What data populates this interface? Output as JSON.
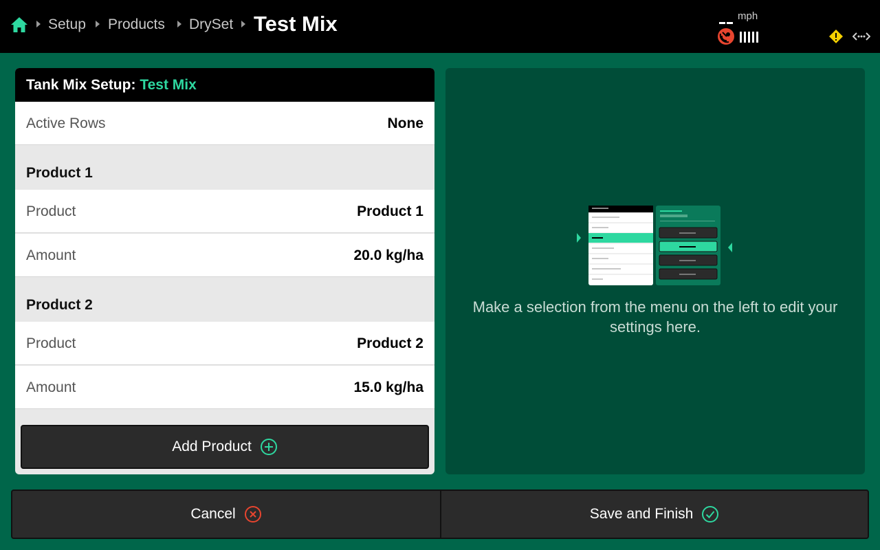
{
  "topbar": {
    "breadcrumbs": [
      "Setup",
      "Products",
      "DrySet"
    ],
    "current": "Test Mix",
    "speed_value": "- -",
    "speed_unit": "mph",
    "icons": [
      "home-icon",
      "gps-icon",
      "signal-bars-icon",
      "warning-icon",
      "connection-icon"
    ]
  },
  "panel": {
    "title_prefix": "Tank Mix Setup:",
    "title_name": "Test Mix",
    "active_rows": {
      "label": "Active Rows",
      "value": "None"
    },
    "products": [
      {
        "section": "Product 1",
        "product_label": "Product",
        "product_value": "Product 1",
        "amount_label": "Amount",
        "amount_value": "20.0 kg/ha"
      },
      {
        "section": "Product 2",
        "product_label": "Product",
        "product_value": "Product 2",
        "amount_label": "Amount",
        "amount_value": "15.0 kg/ha"
      }
    ],
    "add_button": "Add Product"
  },
  "detail": {
    "hint": "Make a selection from the menu on the left to edit your settings here."
  },
  "footer": {
    "cancel": "Cancel",
    "save": "Save and Finish"
  },
  "colors": {
    "background": "#00664a",
    "accent": "#2ed8a0",
    "cancel_icon": "#e8452f",
    "warning": "#f5d000"
  }
}
